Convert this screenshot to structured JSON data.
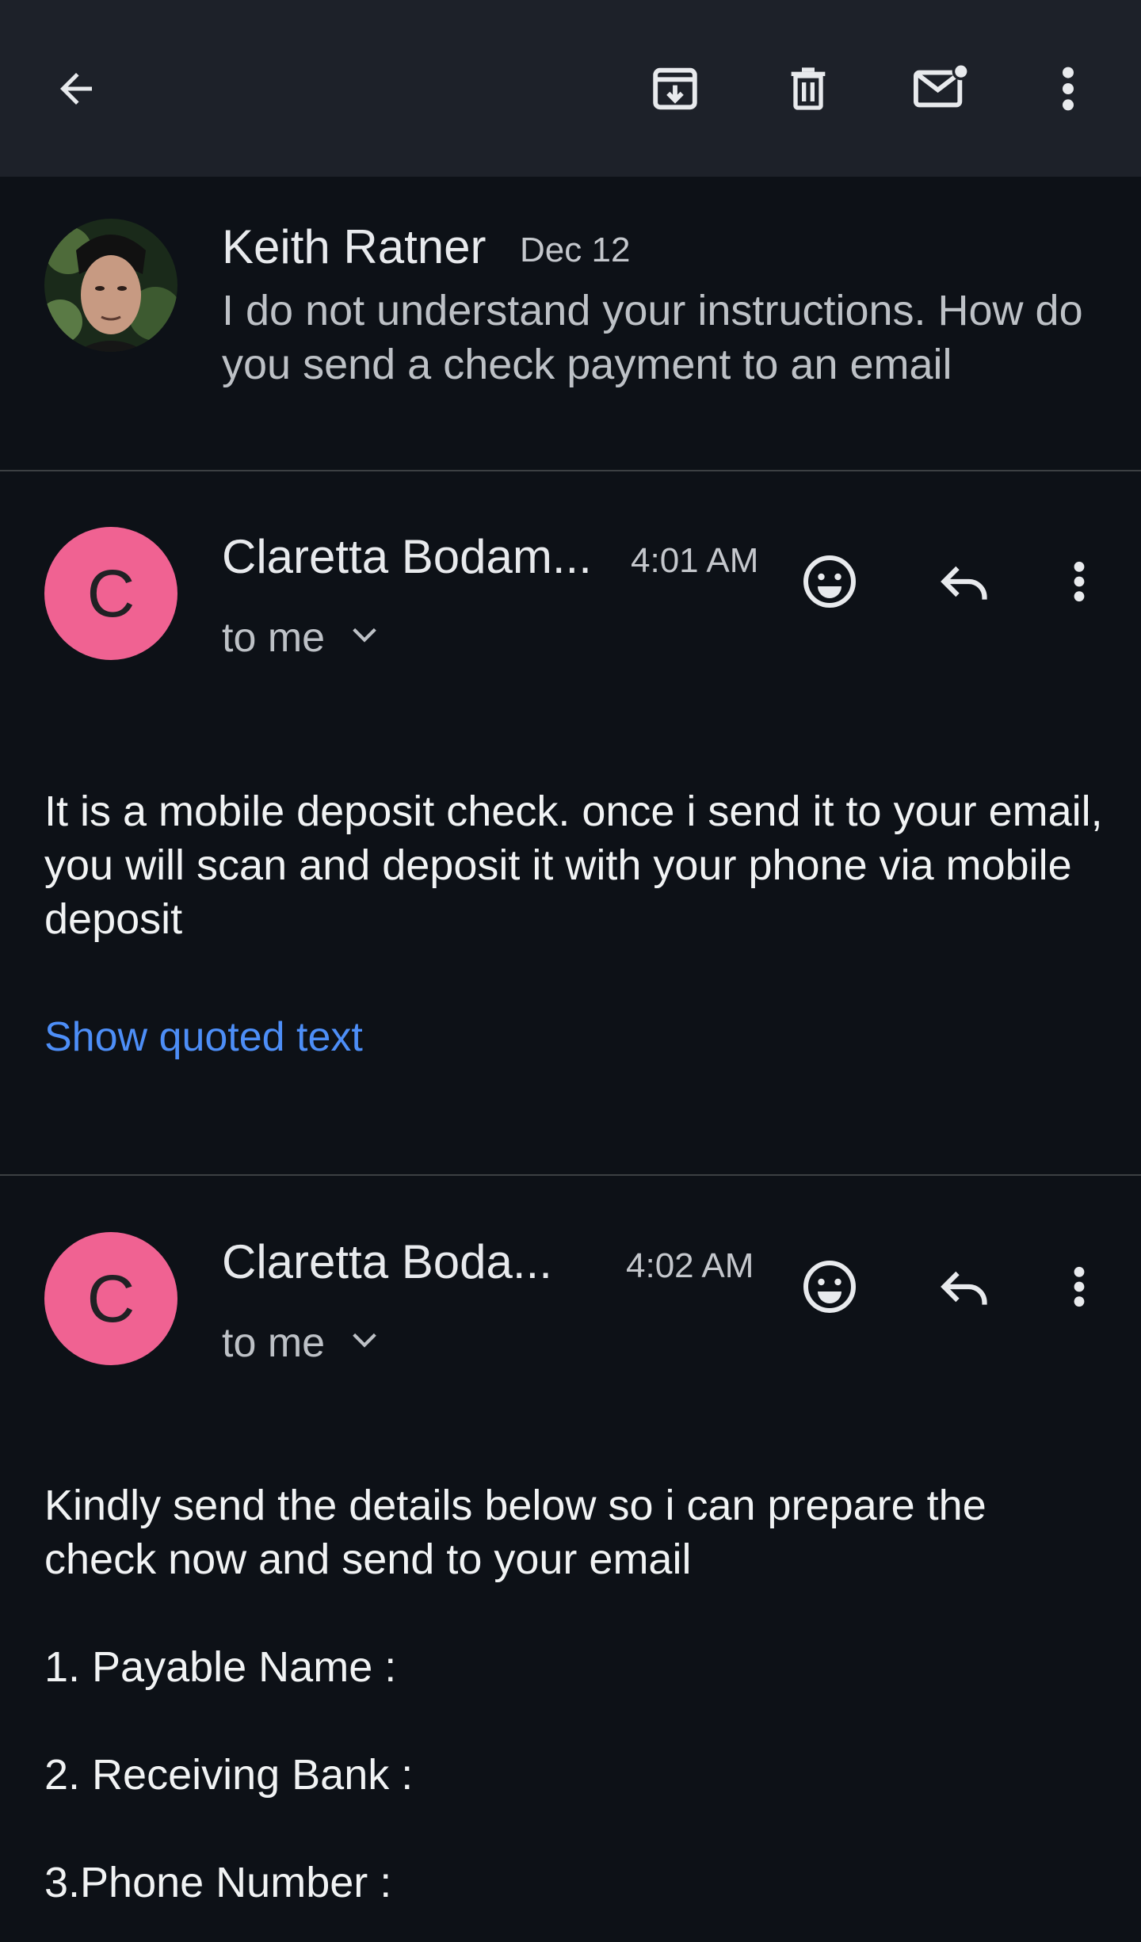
{
  "toolbar": {
    "back_icon": "arrow-left-icon",
    "archive_icon": "archive-icon",
    "delete_icon": "trash-icon",
    "mark_unread_icon": "mail-unread-icon",
    "more_icon": "more-vert-icon"
  },
  "collapsed_message": {
    "sender": "Keith Ratner",
    "date": "Dec 12",
    "snippet": "I do not understand your instructions. How do you send a check payment to an email"
  },
  "message1": {
    "avatar_letter": "C",
    "avatar_color": "#f06292",
    "sender": "Claretta Bodam...",
    "time": "4:01 AM",
    "recipient": "to me",
    "body": "It is a mobile deposit check. once i send it to your email, you will scan and deposit it with your phone via mobile deposit",
    "show_quoted": "Show quoted text"
  },
  "message2": {
    "avatar_letter": "C",
    "avatar_color": "#f06292",
    "sender": "Claretta Boda...",
    "time": "4:02 AM",
    "recipient": "to me",
    "body": "Kindly send the details below so i can prepare the check now and send to your email",
    "item1": "1. Payable Name :",
    "item2": "2. Receiving Bank :",
    "item3": "3.Phone Number :"
  },
  "colors": {
    "background": "#0d1117",
    "toolbar": "#1d2129",
    "link": "#4d8ef7",
    "avatar": "#f06292"
  }
}
